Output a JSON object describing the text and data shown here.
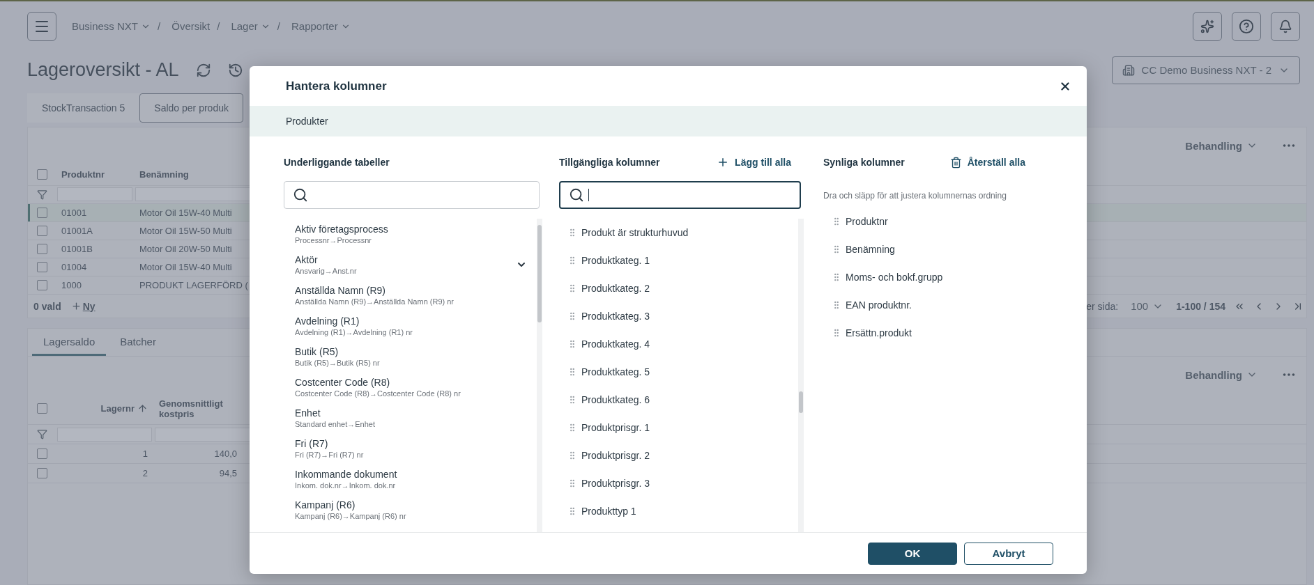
{
  "header": {
    "breadcrumbs": [
      {
        "label": "Business NXT",
        "dropdown": true,
        "separator": "/"
      },
      {
        "label": "Översikt",
        "dropdown": false,
        "separator": "/"
      },
      {
        "label": "Lager",
        "dropdown": true,
        "separator": "/"
      },
      {
        "label": "Rapporter",
        "dropdown": true
      }
    ]
  },
  "page_title": "Lageroversikt - AL",
  "company": "CC Demo Business NXT - 2",
  "view_tabs": [
    {
      "label": "StockTransaction 5",
      "selected": false
    },
    {
      "label": "Saldo per produk",
      "selected": true
    }
  ],
  "top_grid": {
    "action": "Behandling",
    "columns": [
      "Produktnr",
      "Benämning"
    ],
    "header_checked": false,
    "rows": [
      {
        "cells": [
          "01001",
          "Motor Oil 15W-40 Multi"
        ],
        "selected": true,
        "checked": false
      },
      {
        "cells": [
          "01001A",
          "Motor Oil 15W-50 Multi"
        ],
        "selected": false,
        "checked": false
      },
      {
        "cells": [
          "01001B",
          "Motor Oil 20W-50 Multi"
        ],
        "selected": false,
        "checked": false
      },
      {
        "cells": [
          "01004",
          "Motor Oil 15W-40 Multi"
        ],
        "selected": false,
        "checked": false
      },
      {
        "cells": [
          "1000",
          "PRODUKT LAGERFÖRD ("
        ],
        "selected": false,
        "checked": false
      }
    ],
    "selection_count": "0 vald",
    "new_label": "Ny",
    "per_page_label": "er sida:",
    "per_page": "100",
    "range": "1-100 / 154"
  },
  "bottom_grid": {
    "tabs": [
      {
        "label": "Lagersaldo",
        "selected": true
      },
      {
        "label": "Batcher",
        "selected": false
      }
    ],
    "action": "Behandling",
    "columns": [
      "Lagernr",
      "Genomsnittligt kostpris"
    ],
    "header_checked": false,
    "rows": [
      {
        "cells": [
          "1",
          "140,0"
        ],
        "checked": false
      },
      {
        "cells": [
          "2",
          "94,5"
        ],
        "checked": false
      }
    ]
  },
  "dialog": {
    "title": "Hantera kolumner",
    "section": "Produkter",
    "underlying": {
      "heading": "Underliggande tabeller",
      "search_focused": false,
      "items": [
        {
          "name": "Aktiv företagsprocess",
          "path": "Processnr→Processnr",
          "expander": false
        },
        {
          "name": "Aktör",
          "path": "Ansvarig→Anst.nr",
          "expander": true
        },
        {
          "name": "Anställda Namn (R9)",
          "path": "Anställda Namn (R9)→Anställda Namn (R9) nr",
          "expander": false
        },
        {
          "name": "Avdelning (R1)",
          "path": "Avdelning (R1)→Avdelning (R1) nr",
          "expander": false
        },
        {
          "name": "Butik (R5)",
          "path": "Butik (R5)→Butik (R5) nr",
          "expander": false
        },
        {
          "name": "Costcenter Code (R8)",
          "path": "Costcenter Code (R8)→Costcenter Code (R8) nr",
          "expander": false
        },
        {
          "name": "Enhet",
          "path": "Standard enhet→Enhet",
          "expander": false
        },
        {
          "name": "Fri (R7)",
          "path": "Fri (R7)→Fri (R7) nr",
          "expander": false
        },
        {
          "name": "Inkommande dokument",
          "path": "Inkom. dok.nr→Inkom. dok.nr",
          "expander": false
        },
        {
          "name": "Kampanj (R6)",
          "path": "Kampanj (R6)→Kampanj (R6) nr",
          "expander": false
        }
      ]
    },
    "available": {
      "heading": "Tillgängliga kolumner",
      "add_all": "Lägg till alla",
      "search_focused": true,
      "items": [
        "Produkt är strukturhuvud",
        "Produktkateg. 1",
        "Produktkateg. 2",
        "Produktkateg. 3",
        "Produktkateg. 4",
        "Produktkateg. 5",
        "Produktkateg. 6",
        "Produktprisgr. 1",
        "Produktprisgr. 2",
        "Produktprisgr. 3",
        "Produkttyp 1"
      ]
    },
    "visible": {
      "heading": "Synliga kolumner",
      "reset_all": "Återställ alla",
      "hint": "Dra och släpp för att justera kolumnernas ordning",
      "items": [
        "Produktnr",
        "Benämning",
        "Moms- och bokf.grupp",
        "EAN produktnr.",
        "Ersättn.produkt"
      ]
    },
    "buttons": [
      {
        "label": "OK",
        "kind": "primary"
      },
      {
        "label": "Avbryt",
        "kind": "secondary"
      }
    ]
  }
}
